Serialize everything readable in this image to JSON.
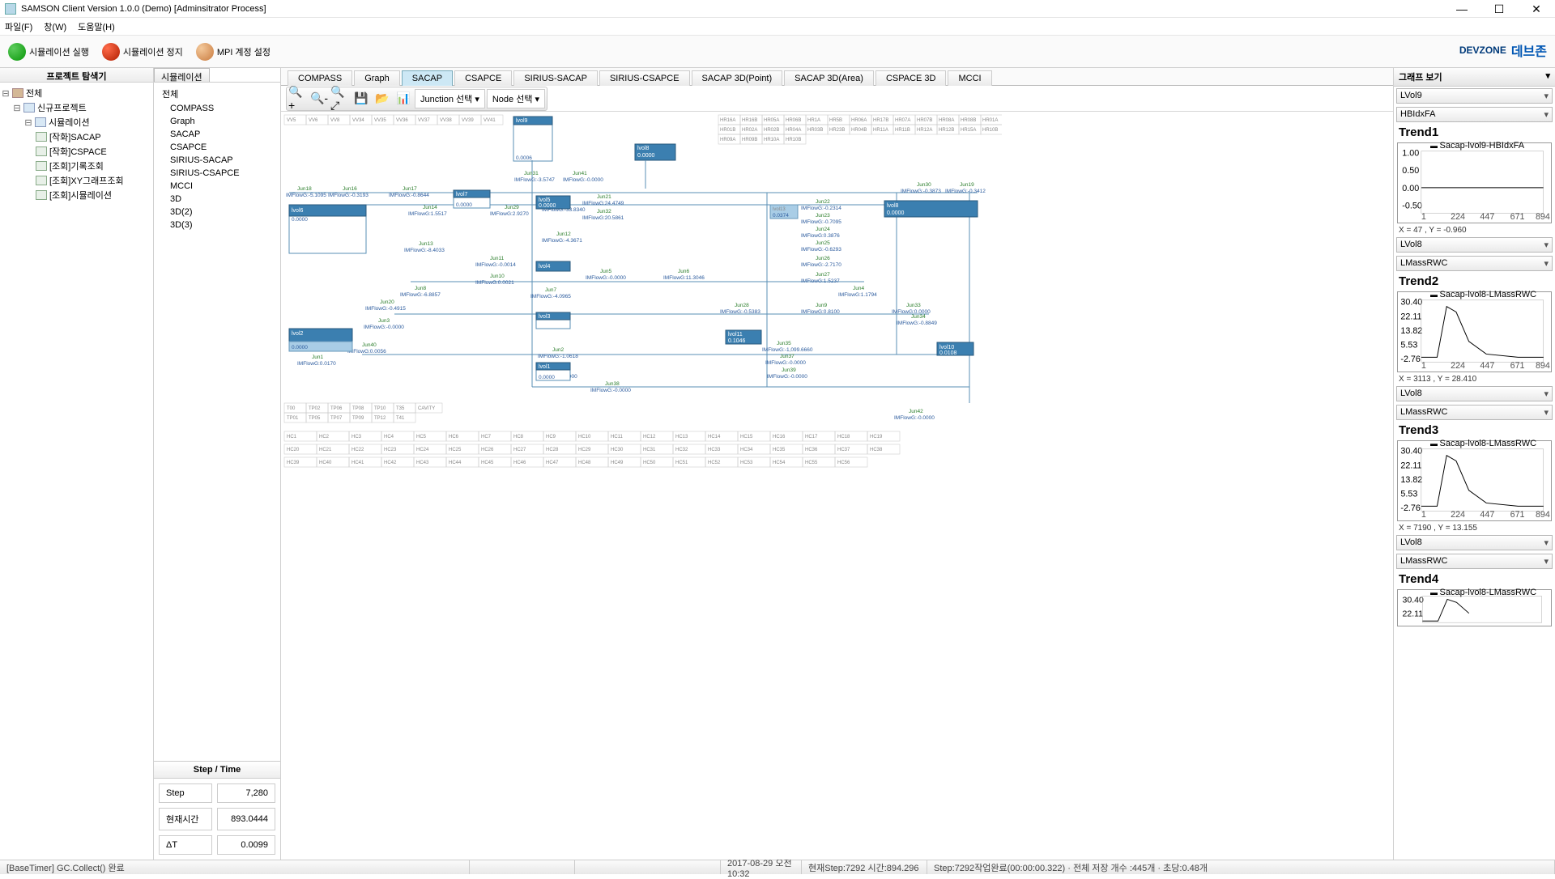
{
  "window": {
    "title": "SAMSON Client Version 1.0.0 (Demo) [Adminsitrator Process]"
  },
  "menu": {
    "file": "파일(F)",
    "window": "창(W)",
    "help": "도움말(H)"
  },
  "toolbar": {
    "run": "시뮬레이션 실행",
    "stop": "시뮬레이션 정지",
    "mpi": "MPI 계정 설정"
  },
  "brand": {
    "zone": "DEVZONE",
    "kor": "데브존"
  },
  "left": {
    "title": "프로젝트 탐색기",
    "nodes": {
      "root": "전체",
      "project": "신규프로젝트",
      "sim": "시뮬레이션",
      "l1": "[작화]SACAP",
      "l2": "[작화]CSPACE",
      "l3": "[조회]기록조회",
      "l4": "[조회]XY그래프조회",
      "l5": "[조회]시뮬레이션"
    }
  },
  "sim": {
    "tab": "시뮬레이션",
    "root": "전체",
    "items": [
      "COMPASS",
      "Graph",
      "SACAP",
      "CSAPCE",
      "SIRIUS-SACAP",
      "SIRIUS-CSAPCE",
      "MCCI",
      "3D",
      "3D(2)",
      "3D(3)"
    ]
  },
  "step": {
    "title": "Step / Time",
    "row1": {
      "k": "Step",
      "v": "7,280"
    },
    "row2": {
      "k": "현재시간",
      "v": "893.0444"
    },
    "row3": {
      "k": "ΔT",
      "v": "0.0099"
    }
  },
  "tabs": {
    "items": [
      "COMPASS",
      "Graph",
      "SACAP",
      "CSAPCE",
      "SIRIUS-SACAP",
      "SIRIUS-CSAPCE",
      "SACAP 3D(Point)",
      "SACAP 3D(Area)",
      "CSPACE 3D",
      "MCCI"
    ],
    "active": 2
  },
  "ct": {
    "junction": "Junction 선택",
    "node": "Node 선택"
  },
  "rp": {
    "title": "그래프 보기",
    "t1": {
      "c1": "LVol9",
      "c2": "HBIdxFA",
      "name": "Trend1",
      "legend": "Sacap-lvol9-HBIdxFA",
      "xy": "X = 47 , Y = -0.960",
      "yticks": [
        "1.00",
        "0.50",
        "0.00",
        "-0.50"
      ],
      "xticks": [
        "1",
        "224",
        "447",
        "671",
        "894"
      ]
    },
    "t2": {
      "c1": "LVol8",
      "c2": "LMassRWC",
      "name": "Trend2",
      "legend": "Sacap-lvol8-LMassRWC",
      "xy": "X = 3113 , Y = 28.410",
      "yticks": [
        "30.40",
        "22.11",
        "13.82",
        "5.53",
        "-2.76"
      ],
      "xticks": [
        "1",
        "224",
        "447",
        "671",
        "894"
      ]
    },
    "t3": {
      "c1": "LVol8",
      "c2": "LMassRWC",
      "name": "Trend3",
      "legend": "Sacap-lvol8-LMassRWC",
      "xy": "X = 7190 , Y = 13.155",
      "yticks": [
        "30.40",
        "22.11",
        "13.82",
        "5.53",
        "-2.76"
      ],
      "xticks": [
        "1",
        "224",
        "447",
        "671",
        "894"
      ]
    },
    "t4": {
      "c1": "LVol8",
      "c2": "LMassRWC",
      "name": "Trend4",
      "legend": "Sacap-lvol8-LMassRWC",
      "yticks": [
        "30.40",
        "22.11"
      ]
    }
  },
  "status": {
    "s1": "[BaseTimer] GC.Collect() 완료",
    "s2": "2017-08-29 오전 10:32",
    "s3": "현재Step:7292 시간:894.296",
    "s4": "Step:7292작업완료(00:00:00.322) · 전체 저장 개수 :445개 · 초당:0.48개"
  }
}
